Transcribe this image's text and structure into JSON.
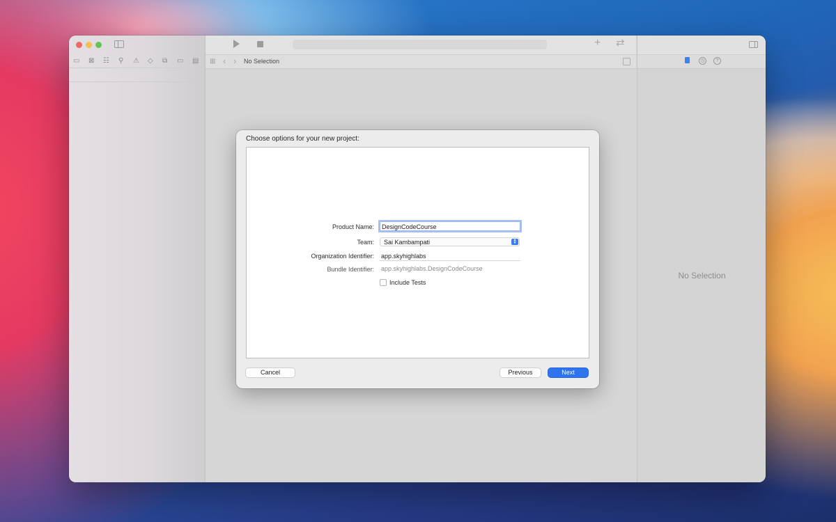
{
  "window": {
    "editor_title": "No Selection",
    "inspector_placeholder": "No Selection"
  },
  "navigator_icons": [
    "folder-icon",
    "source-control-icon",
    "symbol-icon",
    "find-icon",
    "issue-icon",
    "test-icon",
    "debug-icon",
    "breakpoint-icon",
    "report-icon"
  ],
  "dialog": {
    "title": "Choose options for your new project:",
    "fields": {
      "product_name": {
        "label": "Product Name:",
        "value": "DesignCodeCourse"
      },
      "team": {
        "label": "Team:",
        "value": "Sai Kambampati"
      },
      "organization_identifier": {
        "label": "Organization Identifier:",
        "value": "app.skyhighlabs"
      },
      "bundle_identifier": {
        "label": "Bundle Identifier:",
        "value": "app.skyhighlabs.DesignCodeCourse"
      }
    },
    "include_tests": {
      "label": "Include Tests",
      "checked": false
    },
    "buttons": {
      "cancel": "Cancel",
      "previous": "Previous",
      "next": "Next"
    }
  },
  "colors": {
    "accent": "#2f73ef",
    "close": "#ef6a5f",
    "minimize": "#f5be4f",
    "maximize": "#62c554"
  }
}
